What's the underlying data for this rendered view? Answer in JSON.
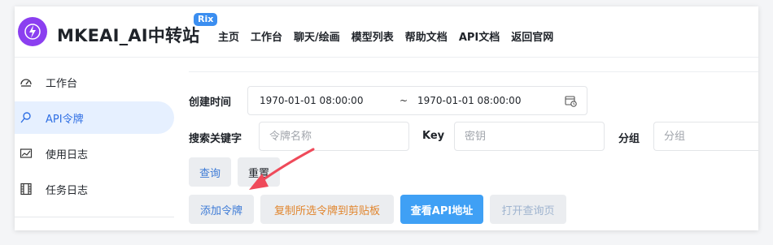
{
  "header": {
    "app_title": "MKEAI_AI中转站",
    "badge": "Rix",
    "nav": [
      "主页",
      "工作台",
      "聊天/绘画",
      "模型列表",
      "帮助文档",
      "API文档",
      "返回官网"
    ]
  },
  "sidebar": {
    "items": [
      {
        "label": "工作台",
        "icon": "dashboard-icon",
        "active": false
      },
      {
        "label": "API令牌",
        "icon": "key-search-icon",
        "active": true
      },
      {
        "label": "使用日志",
        "icon": "log-chart-icon",
        "active": false
      },
      {
        "label": "任务日志",
        "icon": "film-icon",
        "active": false
      }
    ]
  },
  "filters": {
    "created_time_label": "创建时间",
    "date_start": "1970-01-01 08:00:00",
    "date_separator": "~",
    "date_end": "1970-01-01 08:00:00",
    "keyword_label": "搜索关键字",
    "keyword_placeholder": "令牌名称",
    "key_label": "Key",
    "key_placeholder": "密钥",
    "group_label": "分组",
    "group_placeholder": "分组"
  },
  "actions": {
    "query": "查询",
    "reset": "重置",
    "add_token": "添加令牌",
    "copy_selected": "复制所选令牌到剪贴板",
    "view_api_address": "查看API地址",
    "open_query_page": "打开查询页"
  },
  "colors": {
    "accent": "#3fa0f5",
    "brand_purple": "#8b3ff0",
    "active_bg": "#e6f0ff",
    "active_text": "#2f6fe4",
    "annotation_arrow": "#ef4a5a"
  }
}
